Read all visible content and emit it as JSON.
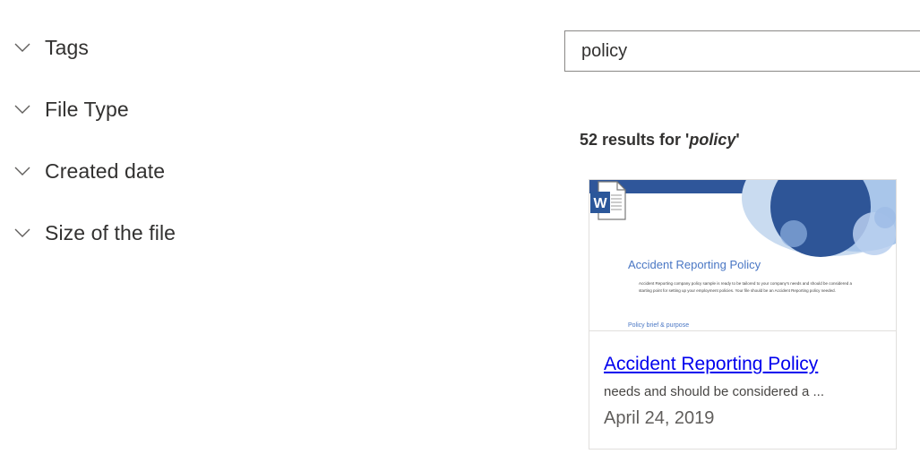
{
  "filters": {
    "items": [
      {
        "label": "Tags"
      },
      {
        "label": "File Type"
      },
      {
        "label": "Created date"
      },
      {
        "label": "Size of the file"
      }
    ]
  },
  "search": {
    "value": "policy"
  },
  "results": {
    "count_prefix": "52 results for '",
    "query": "policy",
    "count_suffix": "'"
  },
  "card": {
    "thumbnail": {
      "doc_title": "Accident Reporting Policy",
      "doc_body": "Accident Reporting company policy sample is ready to be tailored to your company's needs and should be considered a starting point for setting up your employment policies. Your file should be an Accident Reporting policy needed.",
      "doc_subheading": "Policy brief & purpose"
    },
    "title": "Accident Reporting Policy",
    "snippet": "needs and should be considered a ...",
    "date": "April 24, 2019"
  },
  "colors": {
    "link": "#0000ee",
    "word_blue": "#2b579a",
    "thumb_accent": "#2f569a"
  }
}
